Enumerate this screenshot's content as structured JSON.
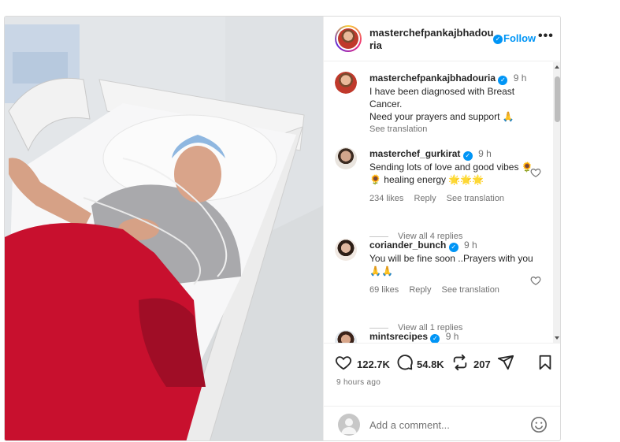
{
  "post": {
    "author": "masterchefpankajbhadouria",
    "follow_label": "Follow",
    "more_icon": "more-horizontal-icon",
    "caption": {
      "username": "masterchefpankajbhadouria",
      "time": "9 h",
      "line1": "I have been diagnosed with Breast Cancer.",
      "line2": "Need your prayers and support 🙏",
      "see_translation": "See translation"
    },
    "comments": [
      {
        "username": "masterchef_gurkirat",
        "time": "9 h",
        "text": "Sending lots of love and good vibes 🌻🌻 healing energy 🌟🌟🌟",
        "likes": "234 likes",
        "reply": "Reply",
        "see_translation": "See translation",
        "view_replies": "View all 4 replies"
      },
      {
        "username": "coriander_bunch",
        "time": "9 h",
        "text": "You will be fine soon ..Prayers with you 🙏🙏",
        "likes": "69 likes",
        "reply": "Reply",
        "see_translation": "See translation",
        "view_replies": "View all 1 replies"
      },
      {
        "username": "mintsrecipes",
        "time": "9 h"
      }
    ],
    "actions": {
      "likes": "122.7K",
      "comments": "54.8K",
      "reposts": "207"
    },
    "time_ago": "9 hours ago",
    "add_comment_placeholder": "Add a comment...",
    "colors": {
      "accent": "#0095f6",
      "muted": "#737373",
      "border": "#dbdbdb"
    }
  }
}
